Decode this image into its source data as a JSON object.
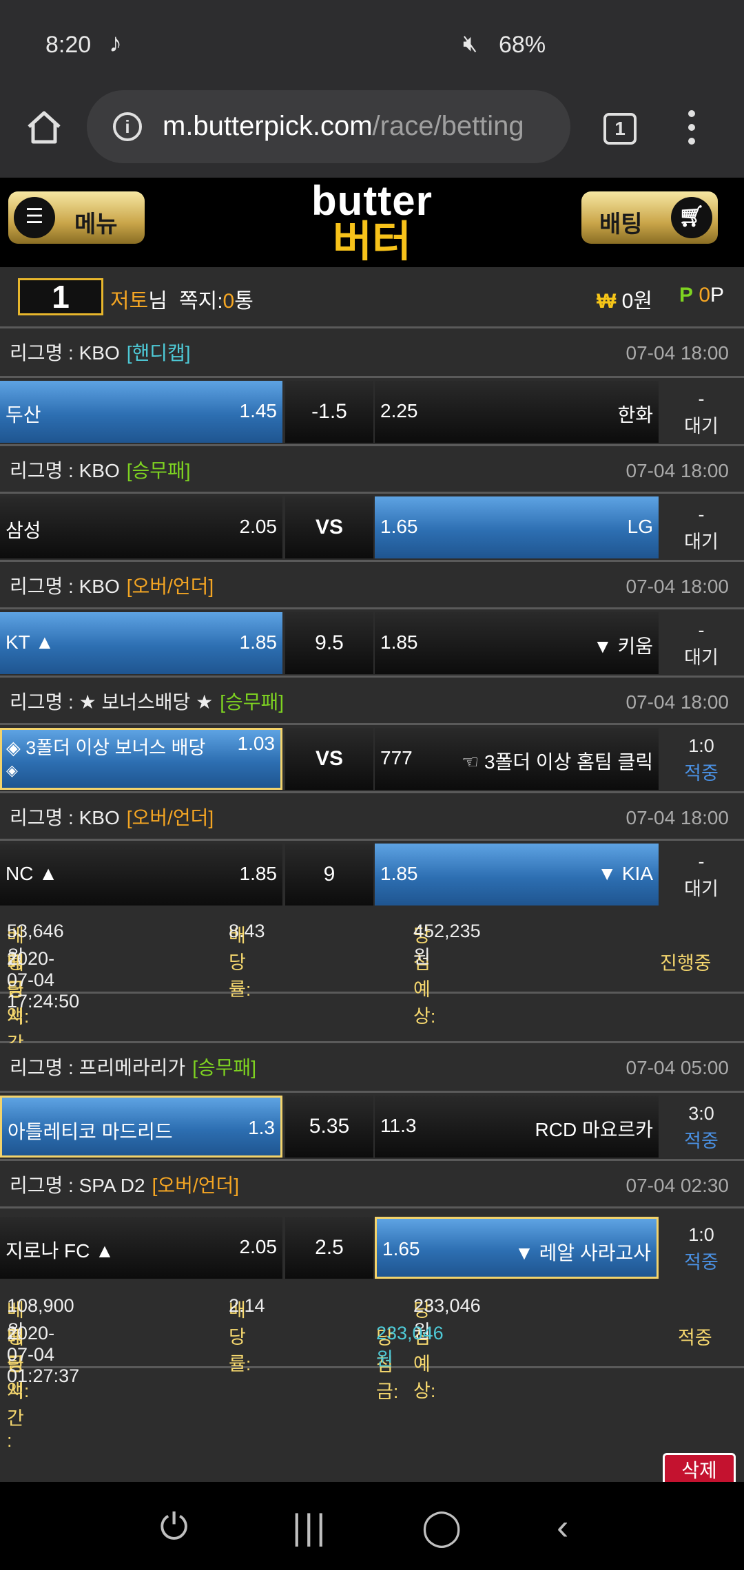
{
  "status": {
    "time": "8:20",
    "battery": "68%"
  },
  "browser": {
    "url_host": "m.butterpick.com",
    "url_path": "/race/betting",
    "tab_count": "1"
  },
  "header": {
    "menu_label": "메뉴",
    "bet_label": "배팅",
    "logo_en": "butter",
    "logo_ko": "버터"
  },
  "user": {
    "level": "1",
    "name": "저토",
    "honorific": "님",
    "note_label": "쪽지:",
    "note_count": "0",
    "note_unit": "통",
    "won_value": "0원",
    "point_value": "0",
    "point_unit": "P"
  },
  "slips": [
    {
      "games": [
        {
          "league": "리그명 : KBO",
          "tag": "[핸디캡]",
          "date": "07-04 18:00",
          "home": "두산",
          "home_odds": "1.45",
          "mid": "-1.5",
          "away_odds": "2.25",
          "away": "한화",
          "res_top": "-",
          "res_bottom": "대기"
        },
        {
          "league": "리그명 : KBO",
          "tag": "[승무패]",
          "date": "07-04 18:00",
          "home": "삼성",
          "home_odds": "2.05",
          "mid": "VS",
          "away_odds": "1.65",
          "away": "LG",
          "res_top": "-",
          "res_bottom": "대기"
        },
        {
          "league": "리그명 : KBO",
          "tag": "[오버/언더]",
          "date": "07-04 18:00",
          "home": "KT ▲",
          "home_odds": "1.85",
          "mid": "9.5",
          "away_odds": "1.85",
          "away": "▼ 키움",
          "res_top": "-",
          "res_bottom": "대기"
        },
        {
          "league": "리그명 : ★ 보너스배당 ★",
          "tag": "[승무패]",
          "date": "07-04 18:00",
          "home": "◈ 3폴더 이상 보너스 배당",
          "home_odds": "1.03",
          "home_extra": "◈",
          "mid": "VS",
          "away_odds": "777",
          "away": "☜ 3폴더 이상 홈팀 클릭",
          "res_top": "1:0",
          "res_bottom": "적중"
        },
        {
          "league": "리그명 : KBO",
          "tag": "[오버/언더]",
          "date": "07-04 18:00",
          "home": "NC ▲",
          "home_odds": "1.85",
          "mid": "9",
          "away_odds": "1.85",
          "away": "▼ KIA",
          "res_top": "-",
          "res_bottom": "대기"
        }
      ],
      "summary": {
        "amount_label": "베팅금액:",
        "amount": "53,646원",
        "rate_label": "배당률:",
        "rate": "8.43",
        "expect_label": "당첨예상:",
        "expect": "452,235원",
        "time_label": "배팅시간 :",
        "time": "2020-07-04 17:24:50",
        "status": "진행중"
      }
    },
    {
      "games": [
        {
          "league": "리그명 : 프리메라리가",
          "tag": "[승무패]",
          "date": "07-04 05:00",
          "home": "아틀레티코 마드리드",
          "home_odds": "1.3",
          "mid": "5.35",
          "away_odds": "11.3",
          "away": "RCD 마요르카",
          "res_top": "3:0",
          "res_bottom": "적중"
        },
        {
          "league": "리그명 : SPA D2",
          "tag": "[오버/언더]",
          "date": "07-04 02:30",
          "home": "지로나 FC ▲",
          "home_odds": "2.05",
          "mid": "2.5",
          "away_odds": "1.65",
          "away": "▼ 레알 사라고사",
          "res_top": "1:0",
          "res_bottom": "적중"
        }
      ],
      "summary": {
        "amount_label": "베팅금액:",
        "amount": "108,900원",
        "rate_label": "배당률:",
        "rate": "2.14",
        "expect_label": "당첨예상:",
        "expect": "233,046원",
        "time_label": "배팅시간 :",
        "time": "2020-07-04 01:27:37",
        "win_label": "당첨금:",
        "win": "233,046원",
        "status": "적중"
      }
    }
  ],
  "delete_label": "삭제",
  "colors": {
    "tag_handicap": "#4ec9d6",
    "tag_wdl": "#7ed321",
    "tag_ou": "#f5a623",
    "selected": "#3d86cf",
    "hit": "#4a90e2"
  }
}
